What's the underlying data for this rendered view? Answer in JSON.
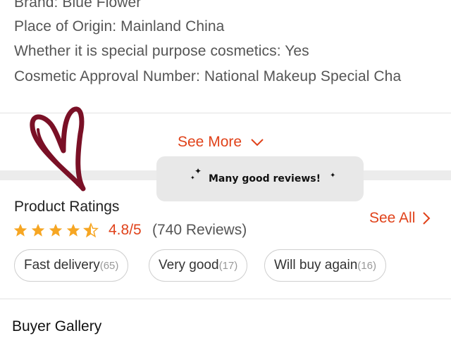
{
  "specs": [
    {
      "label": "Brand",
      "value": "Blue Flower"
    },
    {
      "label": "Place of Origin",
      "value": "Mainland China"
    },
    {
      "label": "Whether it is special purpose cosmetics",
      "value": "Yes"
    },
    {
      "label": "Cosmetic Approval Number",
      "value": "National Makeup Special Cha"
    }
  ],
  "see_more": {
    "label": "See More",
    "icon": "chevron-down-icon"
  },
  "annotation": {
    "text": "Many good reviews!",
    "decoration": "heart-doodle",
    "sparkle": "✦"
  },
  "ratings": {
    "title": "Product Ratings",
    "stars": 4.5,
    "score": "4.8/5",
    "count": "(740 Reviews)",
    "see_all": "See All"
  },
  "tags": [
    {
      "label": "Fast delivery",
      "count": "(65)"
    },
    {
      "label": "Very good",
      "count": "(17)"
    },
    {
      "label": "Will buy again",
      "count": "(16)"
    }
  ],
  "gallery": {
    "title": "Buyer Gallery"
  },
  "colors": {
    "accent": "#e0421a",
    "star": "#f6a623",
    "heart": "#7a1026"
  }
}
